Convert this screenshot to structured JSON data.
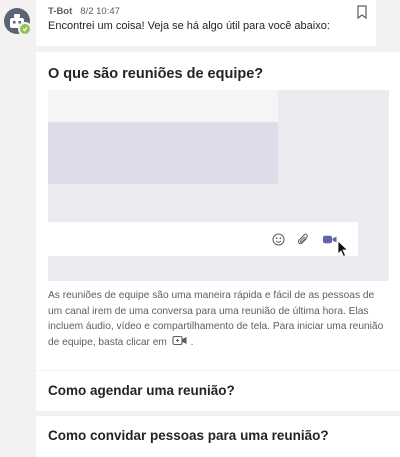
{
  "message": {
    "sender": "T-Bot",
    "time": "8/2 10:47",
    "text": "Encontrei um coisa! Veja se há algo útil para você abaixo:"
  },
  "answer_card": {
    "title": "O que são reuniões de equipe?",
    "description_before_icon": "As reuniões de equipe são uma maneira rápida e fácil de as pessoas de um canal irem de uma conversa para uma reunião de última hora. Elas incluem áudio, vídeo e compartilhamento de tela. Para iniciar uma reunião de equipe, basta clicar em",
    "description_after_icon": "."
  },
  "related_questions": [
    {
      "title": "Como agendar uma reunião?"
    },
    {
      "title": "Como convidar pessoas para uma reunião?"
    }
  ],
  "icons": {
    "avatar": "bot-icon",
    "presence": "available-check-icon",
    "bookmark": "bookmark-icon",
    "compose": [
      "emoji-icon",
      "attach-icon",
      "meet-now-icon"
    ],
    "cursor": "mouse-pointer-icon"
  },
  "colors": {
    "accent": "#6264a7",
    "presence_available": "#92c353"
  }
}
